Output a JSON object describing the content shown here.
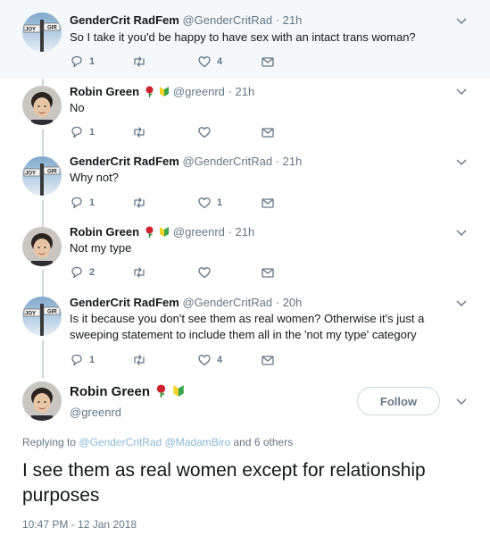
{
  "tweets": [
    {
      "name": "GenderCrit RadFem",
      "handle": "@GenderCritRad",
      "time": "21h",
      "text": "So I take it you'd be happy to have sex with an intact trans woman?",
      "reply_count": "1",
      "retweet_count": "",
      "like_count": "4"
    },
    {
      "name": "Robin Green",
      "handle": "@greenrd",
      "time": "21h",
      "text": "No",
      "reply_count": "1",
      "retweet_count": "",
      "like_count": ""
    },
    {
      "name": "GenderCrit RadFem",
      "handle": "@GenderCritRad",
      "time": "21h",
      "text": "Why not?",
      "reply_count": "1",
      "retweet_count": "",
      "like_count": "1"
    },
    {
      "name": "Robin Green",
      "handle": "@greenrd",
      "time": "21h",
      "text": "Not my type",
      "reply_count": "2",
      "retweet_count": "",
      "like_count": ""
    },
    {
      "name": "GenderCrit RadFem",
      "handle": "@GenderCritRad",
      "time": "20h",
      "text": "Is it because you don't see them as real women? Otherwise it's just a sweeping statement to include them all in the 'not my type' category",
      "reply_count": "1",
      "retweet_count": "",
      "like_count": "4"
    }
  ],
  "separator": "·",
  "main_tweet": {
    "name": "Robin Green",
    "handle": "@greenrd",
    "follow_label": "Follow",
    "replying_prefix": "Replying to",
    "replying_mentions": "@GenderCritRad @MadamBiro",
    "replying_suffix": "and 6 others",
    "text": "I see them as real women except for relationship purposes",
    "timestamp": "10:47 PM - 12 Jan 2018"
  },
  "icons": {
    "reply": "reply-icon",
    "retweet": "retweet-icon",
    "like": "heart-icon",
    "dm": "envelope-icon",
    "caret": "chevron-down-icon",
    "rose": "rose-emoji",
    "beginner": "japanese-beginner-symbol-emoji"
  },
  "colors": {
    "text": "#14171a",
    "secondary": "#657786",
    "highlight_bg": "#f5f8fa",
    "thread_line": "#ccd6dd",
    "mention": "#8ab8d6"
  }
}
